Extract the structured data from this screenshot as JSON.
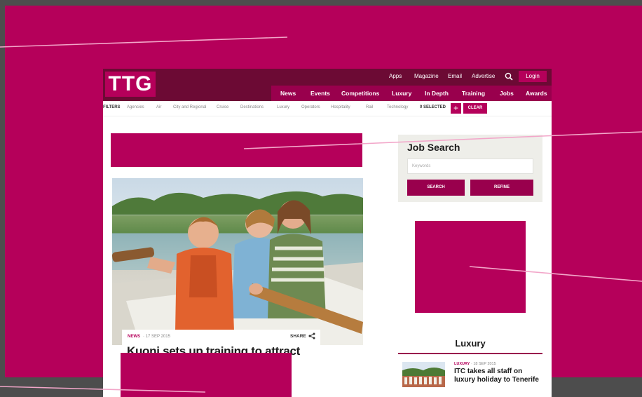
{
  "colors": {
    "brand": "#b5005a",
    "nav_dark": "#6c0a34",
    "nav_mid": "#99004d",
    "frame": "#4d4d4d",
    "callout_line": "#f2a6c9"
  },
  "site": {
    "logo": "TTG",
    "utility_links": [
      "Apps",
      "Magazine",
      "Email",
      "Advertise"
    ],
    "search_icon": "search-icon",
    "login_label": "Login",
    "main_nav": [
      "News",
      "Events",
      "Competitions",
      "Luxury",
      "In Depth",
      "Training",
      "Jobs",
      "Awards"
    ]
  },
  "filters": {
    "label": "FILTERS",
    "items": [
      "Agencies",
      "Air",
      "City and Regional",
      "Cruise",
      "Destinations",
      "Luxury",
      "Operators",
      "Hospitality",
      "Rail",
      "Technology"
    ],
    "selected_text": "0 SELECTED",
    "add_label": "+",
    "clear_label": "CLEAR"
  },
  "article": {
    "tag": "NEWS",
    "date": "· 17 SEP 2015",
    "share_label": "SHARE",
    "share_icon": "share-icon",
    "headline": "Kuoni sets up training to attract"
  },
  "job_search": {
    "title": "Job Search",
    "keyword_placeholder": "Keywords",
    "search_label": "SEARCH",
    "refine_label": "REFINE"
  },
  "luxury": {
    "section_title": "Luxury",
    "item": {
      "tag": "LUXURY",
      "date": "· 18 SEP 2015",
      "title": "ITC takes all staff on luxury holiday to Tenerife"
    }
  }
}
